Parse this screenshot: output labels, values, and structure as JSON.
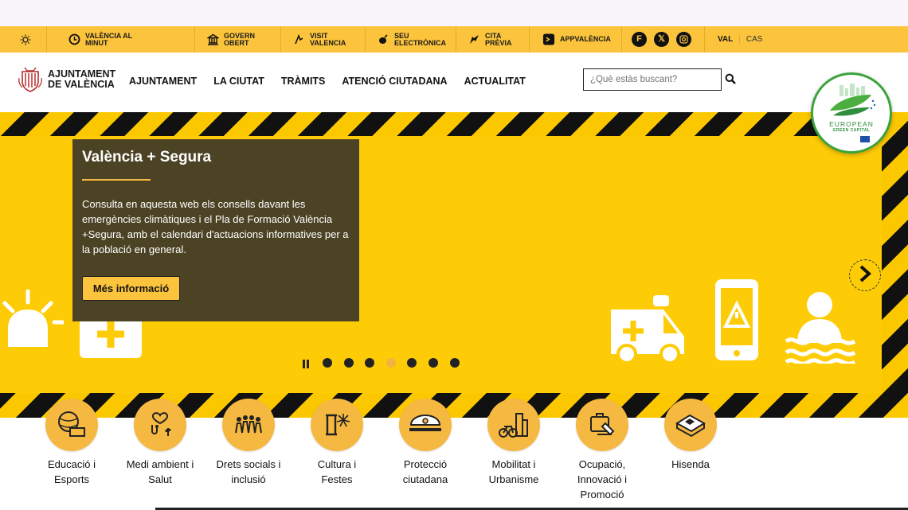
{
  "utility_bar": {
    "items": [
      {
        "icon": "clock-icon",
        "label": "VALÈNCIA AL MINUT"
      },
      {
        "icon": "government-building-icon",
        "label": "GOVERN OBERT"
      },
      {
        "icon": "visit-icon",
        "label": "VISIT VALENCIA"
      },
      {
        "icon": "e-office-icon",
        "label": "SEU ELECTRÒNICA"
      },
      {
        "icon": "appointment-icon",
        "label": "CITA PRÈVIA"
      },
      {
        "icon": "app-icon",
        "label": "APPVALÈNCIA"
      }
    ],
    "social": [
      "facebook-icon",
      "x-icon",
      "instagram-icon"
    ],
    "languages": {
      "active": "VAL",
      "other": "CAS"
    }
  },
  "header": {
    "logo_text": [
      "AJUNTAMENT",
      "DE VALÈNCIA"
    ],
    "nav": [
      "AJUNTAMENT",
      "LA CIUTAT",
      "TRÀMITS",
      "ATENCIÓ CIUTADANA",
      "ACTUALITAT"
    ],
    "search_placeholder": "¿Què estàs buscant?"
  },
  "badge": {
    "line1": "EUROPEAN",
    "line2": "GREEN CAPITAL"
  },
  "hero": {
    "title": "València + Segura",
    "body": "Consulta en aquesta web els consells davant les emergències climàtiques i el Pla de Formació València +Segura, amb el calendari d'actuacions informatives per a la població en general.",
    "button": "Més informació",
    "slides_count": 7,
    "active_slide": 4
  },
  "categories": [
    {
      "icon": "education-sports-icon",
      "label": "Educació i Esports"
    },
    {
      "icon": "environment-health-icon",
      "label": "Medi ambient i Salut"
    },
    {
      "icon": "social-rights-icon",
      "label": "Drets socials i inclusió"
    },
    {
      "icon": "culture-festivals-icon",
      "label": "Cultura i Festes"
    },
    {
      "icon": "civil-protection-icon",
      "label": "Protecció ciutadana"
    },
    {
      "icon": "mobility-urbanism-icon",
      "label": "Mobilitat i Urbanisme"
    },
    {
      "icon": "employment-innovation-icon",
      "label": "Ocupació, Innovació i Promoció"
    },
    {
      "icon": "finance-icon",
      "label": "Hisenda"
    }
  ],
  "colors": {
    "accent": "#fbc43c",
    "hero_yellow": "#fdcc07",
    "card_bg": "#4c4325",
    "category_circle": "#f5b841"
  }
}
